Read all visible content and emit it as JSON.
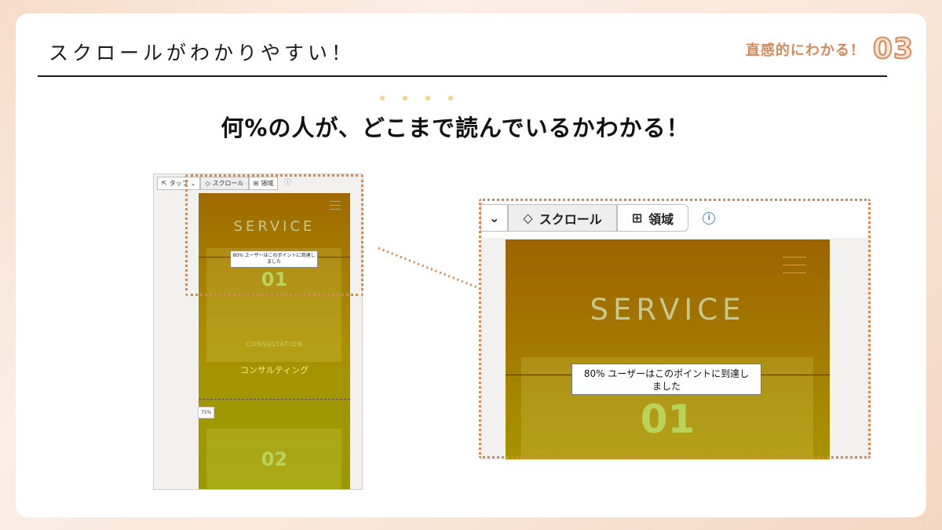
{
  "slide": {
    "title": "スクロールがわかりやすい！",
    "tag_label": "直感的にわかる！",
    "tag_number": "03",
    "headline": "何%の人が、どこまで読んでいるかわかる！"
  },
  "small_view": {
    "toolbar": {
      "tap_label": "タップ",
      "scroll_label": "スクロール",
      "area_label": "領域"
    },
    "page": {
      "heading": "SERVICE",
      "tooltip": "80% ユーザーはこのポイントに到達しました",
      "item1_number": "01",
      "item1_en": "CONSULTATION",
      "item1_jp": "コンサルティング",
      "marker_75": "75%",
      "item2_number": "02"
    }
  },
  "large_view": {
    "toolbar": {
      "scroll_label": "スクロール",
      "area_label": "領域"
    },
    "page": {
      "heading": "SERVICE",
      "tooltip_line1": "80% ユーザーはこのポイントに到達し",
      "tooltip_line2": "ました",
      "item1_number": "01"
    }
  },
  "colors": {
    "accent": "#d58a5d",
    "dots": "#f4d38a",
    "heatmap_top": "#9e6a00",
    "heatmap_bottom": "#9a9a00",
    "info": "#4a8ec9"
  }
}
